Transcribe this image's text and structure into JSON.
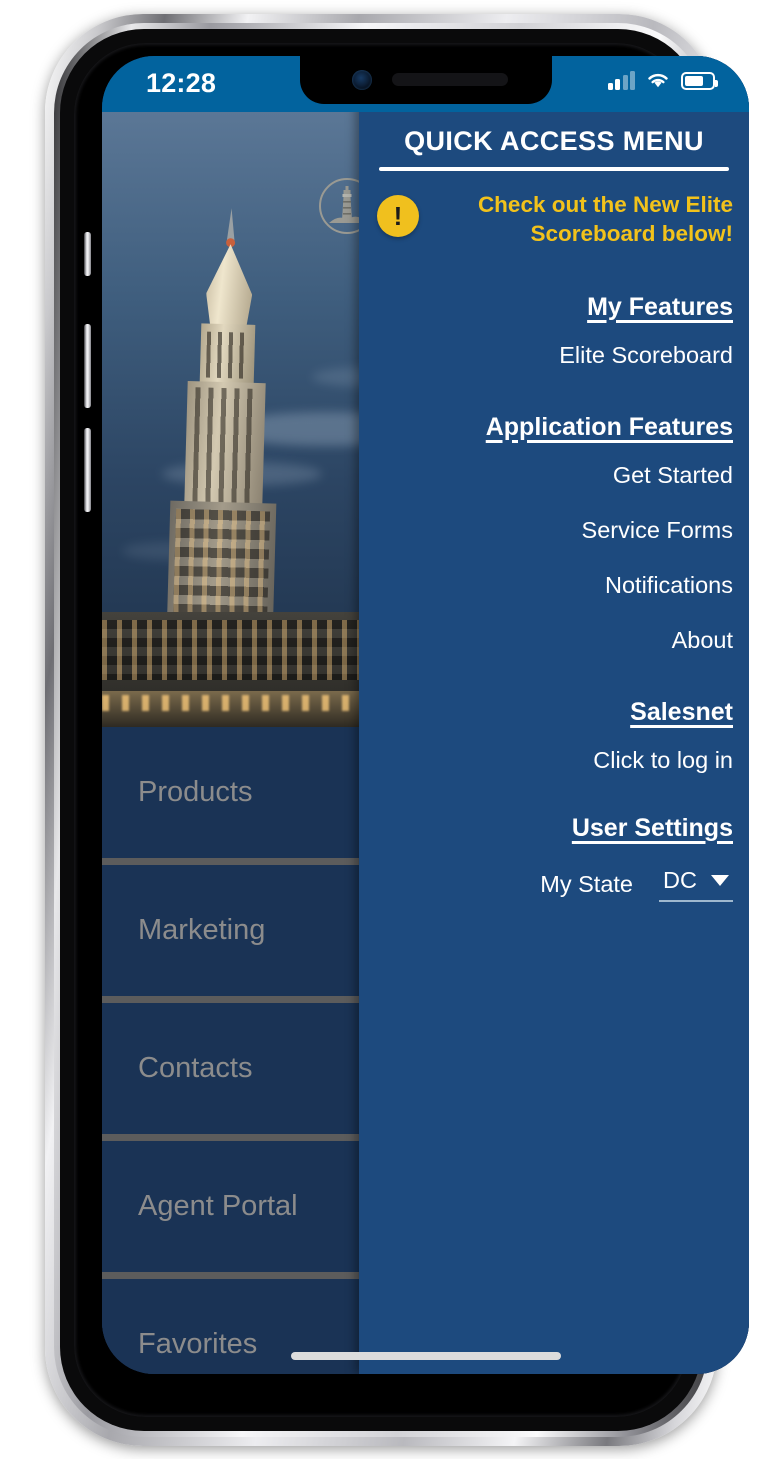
{
  "status_bar": {
    "time": "12:28",
    "signal_icon": "signal-bars-icon",
    "wifi_icon": "wifi-icon",
    "battery_icon": "battery-icon",
    "bars_filled": 2,
    "bars_total": 4,
    "battery_percent": 70
  },
  "brand": {
    "logo_icon": "lighthouse-logo-icon"
  },
  "background": {
    "hero_image_alt": "city skyline at dusk with clock tower"
  },
  "sidebar": {
    "items": [
      {
        "label": "Products"
      },
      {
        "label": "Marketing"
      },
      {
        "label": "Contacts"
      },
      {
        "label": "Agent Portal"
      },
      {
        "label": "Favorites"
      }
    ]
  },
  "panel": {
    "title": "QUICK ACCESS MENU",
    "notice": {
      "icon": "alert-exclamation-icon",
      "text": "Check out the New Elite Scoreboard below!",
      "color": "#f2c21b"
    },
    "groups": [
      {
        "heading": "My Features",
        "items": [
          {
            "label": "Elite Scoreboard"
          }
        ]
      },
      {
        "heading": "Application Features",
        "items": [
          {
            "label": "Get Started"
          },
          {
            "label": "Service Forms"
          },
          {
            "label": "Notifications"
          },
          {
            "label": "About"
          }
        ]
      },
      {
        "heading": "Salesnet",
        "items": [
          {
            "label": "Click to log in"
          }
        ]
      }
    ],
    "user_settings": {
      "heading": "User Settings",
      "state_label": "My State",
      "state_value": "DC",
      "caret_icon": "chevron-down-icon"
    }
  },
  "system": {
    "home_indicator": "home-indicator"
  },
  "colors": {
    "status_bar": "#02639e",
    "panel": "#1d4a7e",
    "tile": "#1a3355",
    "accent_yellow": "#f0c01e",
    "tile_label": "#8c8c8c",
    "separator": "#5c5c5c"
  }
}
